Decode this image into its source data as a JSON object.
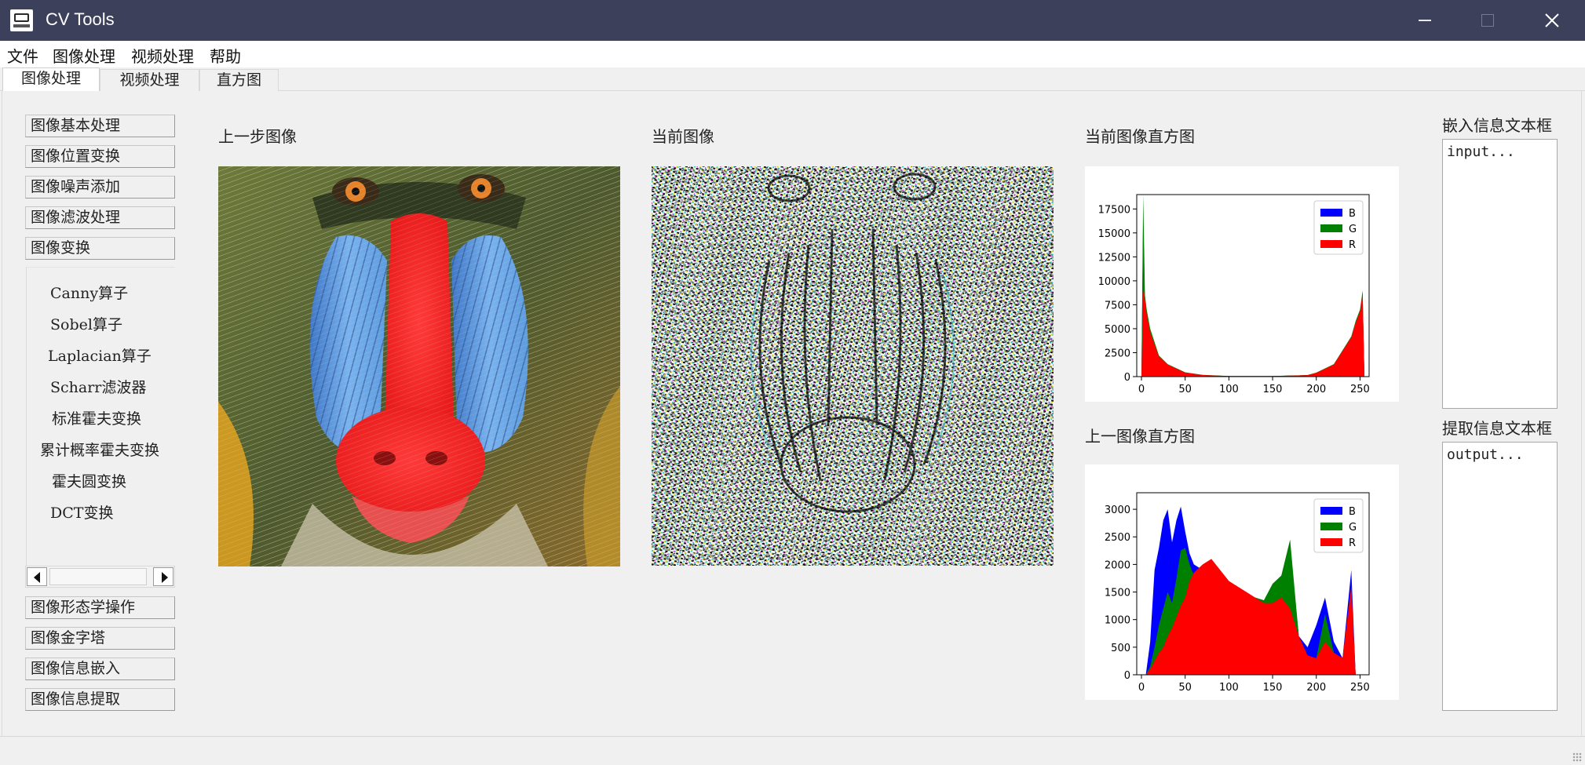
{
  "window": {
    "title": "CV Tools",
    "icon": "app-window-icon",
    "controls": {
      "minimize": "minimize-icon",
      "maximize": "maximize-icon",
      "close": "close-icon"
    }
  },
  "menu": {
    "items": [
      "文件",
      "图像处理",
      "视频处理",
      "帮助"
    ]
  },
  "tabs": {
    "items": [
      "图像处理",
      "视频处理",
      "直方图"
    ],
    "active": "图像处理"
  },
  "sidebar": {
    "top_buttons": [
      "图像基本处理",
      "图像位置变换",
      "图像噪声添加",
      "图像滤波处理",
      "图像变换"
    ],
    "transform_items": [
      "Canny算子",
      "Sobel算子",
      "Laplacian算子",
      "Scharr滤波器",
      "标准霍夫变换",
      "累计概率霍夫变换",
      "霍夫圆变换",
      "DCT变换"
    ],
    "bottom_buttons": [
      "图像形态学操作",
      "图像金字塔",
      "图像信息嵌入",
      "图像信息提取"
    ]
  },
  "panels": {
    "previous_image_caption": "上一步图像",
    "current_image_caption": "当前图像",
    "current_hist_caption": "当前图像直方图",
    "previous_hist_caption": "上一图像直方图",
    "embed_caption": "嵌入信息文本框",
    "extract_caption": "提取信息文本框",
    "embed_placeholder": "input...",
    "extract_placeholder": "output..."
  },
  "colors": {
    "titlebar": "#3c405a",
    "series_b": "#0000ff",
    "series_g": "#008000",
    "series_r": "#ff0000"
  },
  "chart_data": [
    {
      "type": "area",
      "xlim": [
        0,
        255
      ],
      "ylim": [
        0,
        19000
      ],
      "xticks": [
        0,
        50,
        100,
        150,
        200,
        250
      ],
      "yticks": [
        0,
        2500,
        5000,
        7500,
        10000,
        12500,
        15000,
        17500
      ],
      "yticks_shown": [
        "0",
        "2500",
        "5000",
        "7500",
        "10000",
        "12500",
        "15000",
        "17500"
      ],
      "legend": [
        "B",
        "G",
        "R"
      ],
      "legend_position": "top-right",
      "series": [
        {
          "name": "B",
          "x": [
            0,
            2,
            4,
            6,
            10,
            20,
            30,
            50,
            70,
            100,
            150,
            190,
            200,
            220,
            240,
            245,
            250,
            253,
            255
          ],
          "values": [
            0,
            17000,
            7000,
            6000,
            4500,
            2000,
            1200,
            400,
            150,
            50,
            50,
            150,
            400,
            1200,
            4000,
            5500,
            6500,
            8500,
            0
          ]
        },
        {
          "name": "G",
          "x": [
            0,
            2,
            4,
            6,
            10,
            20,
            30,
            50,
            70,
            100,
            150,
            190,
            200,
            220,
            240,
            245,
            250,
            253,
            255
          ],
          "values": [
            0,
            19000,
            8500,
            7000,
            5000,
            2200,
            1300,
            450,
            180,
            60,
            60,
            160,
            420,
            1300,
            4200,
            5800,
            7000,
            9000,
            0
          ]
        },
        {
          "name": "R",
          "x": [
            0,
            2,
            4,
            6,
            10,
            20,
            30,
            50,
            70,
            100,
            150,
            190,
            200,
            220,
            240,
            245,
            250,
            253,
            255
          ],
          "values": [
            0,
            9000,
            8000,
            6500,
            4600,
            2100,
            1250,
            420,
            160,
            50,
            50,
            150,
            400,
            1250,
            4100,
            5600,
            6800,
            8800,
            0
          ]
        }
      ]
    },
    {
      "type": "area",
      "xlim": [
        0,
        255
      ],
      "ylim": [
        0,
        3300
      ],
      "xticks": [
        0,
        50,
        100,
        150,
        200,
        250
      ],
      "yticks": [
        0,
        500,
        1000,
        1500,
        2000,
        2500,
        3000
      ],
      "legend": [
        "B",
        "G",
        "R"
      ],
      "legend_position": "top-right",
      "series": [
        {
          "name": "B",
          "x": [
            5,
            10,
            15,
            20,
            25,
            30,
            35,
            40,
            45,
            50,
            55,
            60,
            70,
            80,
            100,
            120,
            140,
            150,
            160,
            170,
            180,
            190,
            200,
            210,
            220,
            230,
            240,
            245
          ],
          "values": [
            0,
            600,
            1900,
            2300,
            2800,
            3000,
            2400,
            2800,
            3050,
            2600,
            2200,
            2000,
            1900,
            1900,
            1600,
            1450,
            1350,
            1500,
            1700,
            2300,
            700,
            500,
            900,
            1400,
            600,
            300,
            1900,
            0
          ]
        },
        {
          "name": "G",
          "x": [
            5,
            10,
            15,
            20,
            25,
            30,
            35,
            40,
            45,
            50,
            55,
            60,
            70,
            80,
            100,
            120,
            140,
            150,
            160,
            170,
            180,
            190,
            200,
            210,
            220,
            230,
            240,
            245
          ],
          "values": [
            0,
            150,
            500,
            900,
            1200,
            1500,
            1300,
            1750,
            2250,
            2300,
            2000,
            1800,
            1900,
            1900,
            1600,
            1450,
            1350,
            1650,
            1800,
            2450,
            700,
            300,
            300,
            1100,
            400,
            300,
            1600,
            0
          ]
        },
        {
          "name": "R",
          "x": [
            5,
            10,
            15,
            20,
            25,
            30,
            35,
            40,
            45,
            50,
            55,
            60,
            70,
            80,
            100,
            120,
            140,
            150,
            160,
            170,
            180,
            190,
            200,
            210,
            220,
            230,
            240,
            245
          ],
          "values": [
            0,
            100,
            250,
            400,
            500,
            700,
            850,
            1050,
            1250,
            1400,
            1700,
            1850,
            2000,
            2100,
            1700,
            1500,
            1300,
            1300,
            1400,
            1200,
            700,
            350,
            300,
            600,
            400,
            300,
            1600,
            0
          ]
        }
      ]
    }
  ]
}
